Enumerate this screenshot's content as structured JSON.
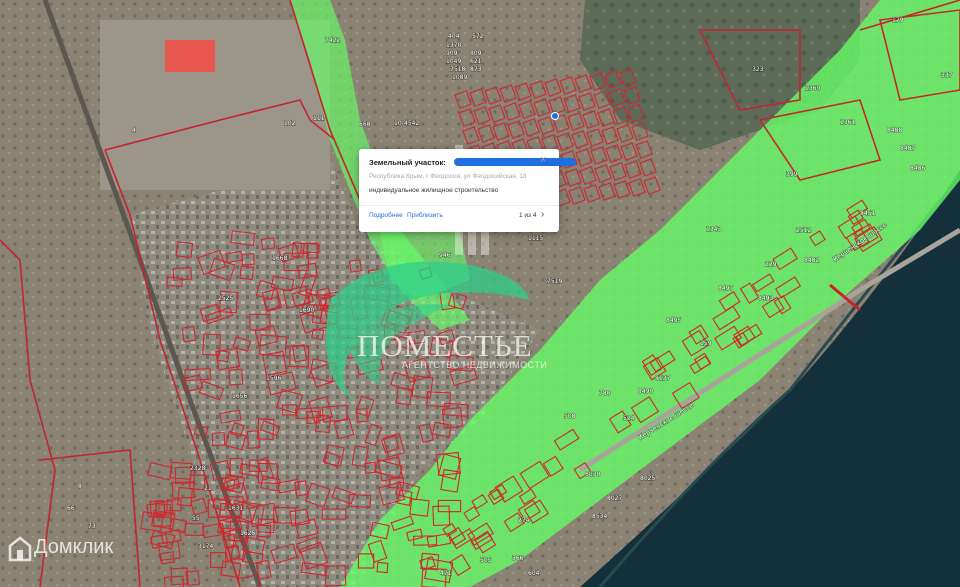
{
  "popup": {
    "title": "Земельный участок:",
    "address": "Республика Крым, г Феодосия, ул Феодосийская, 18",
    "purpose": "индивидуальное жилищное строительство",
    "link_details": "Подробнее",
    "link_zoom": "Приблизить",
    "pager": "1 из 4",
    "close_icon": "close-icon",
    "next_icon": "chevron-right-icon",
    "highlight_color": "#1f6fe0"
  },
  "watermark": {
    "brand": "ПОМЕСТЬЕ",
    "tagline": "АГЕНТСТВО НЕДВИЖИМОСТИ",
    "source": "Домклик"
  },
  "map": {
    "parcel_outline_color": "#d0282d",
    "zone_fill_color": "#66ff66",
    "sea_color": "#14303a"
  },
  "parcel_labels": [
    "7422",
    "404",
    "572",
    "1370",
    "909",
    "1049",
    "809",
    "621",
    "7518",
    "873",
    "1089",
    "668",
    "10",
    "4542",
    "4",
    "111",
    "102",
    "66",
    "73",
    "8",
    "399",
    "1360",
    "1361",
    "8488",
    "8487",
    "8486",
    "337",
    "179",
    "323",
    "2512",
    "229",
    "1343",
    "7519",
    "946",
    "8490",
    "8495",
    "8497",
    "8493",
    "8482",
    "8451",
    "780",
    "524",
    "508",
    "159",
    "8137",
    "8030",
    "8027",
    "8025",
    "274",
    "366",
    "471",
    "505",
    "604",
    "8534",
    "1668",
    "1690",
    "1596",
    "1656",
    "2328",
    "3174",
    "55",
    "21",
    "1631",
    "1625",
    "2525",
    "1115"
  ],
  "road_labels": [
    "Керченское шоссе",
    "Керченское шоссе"
  ]
}
